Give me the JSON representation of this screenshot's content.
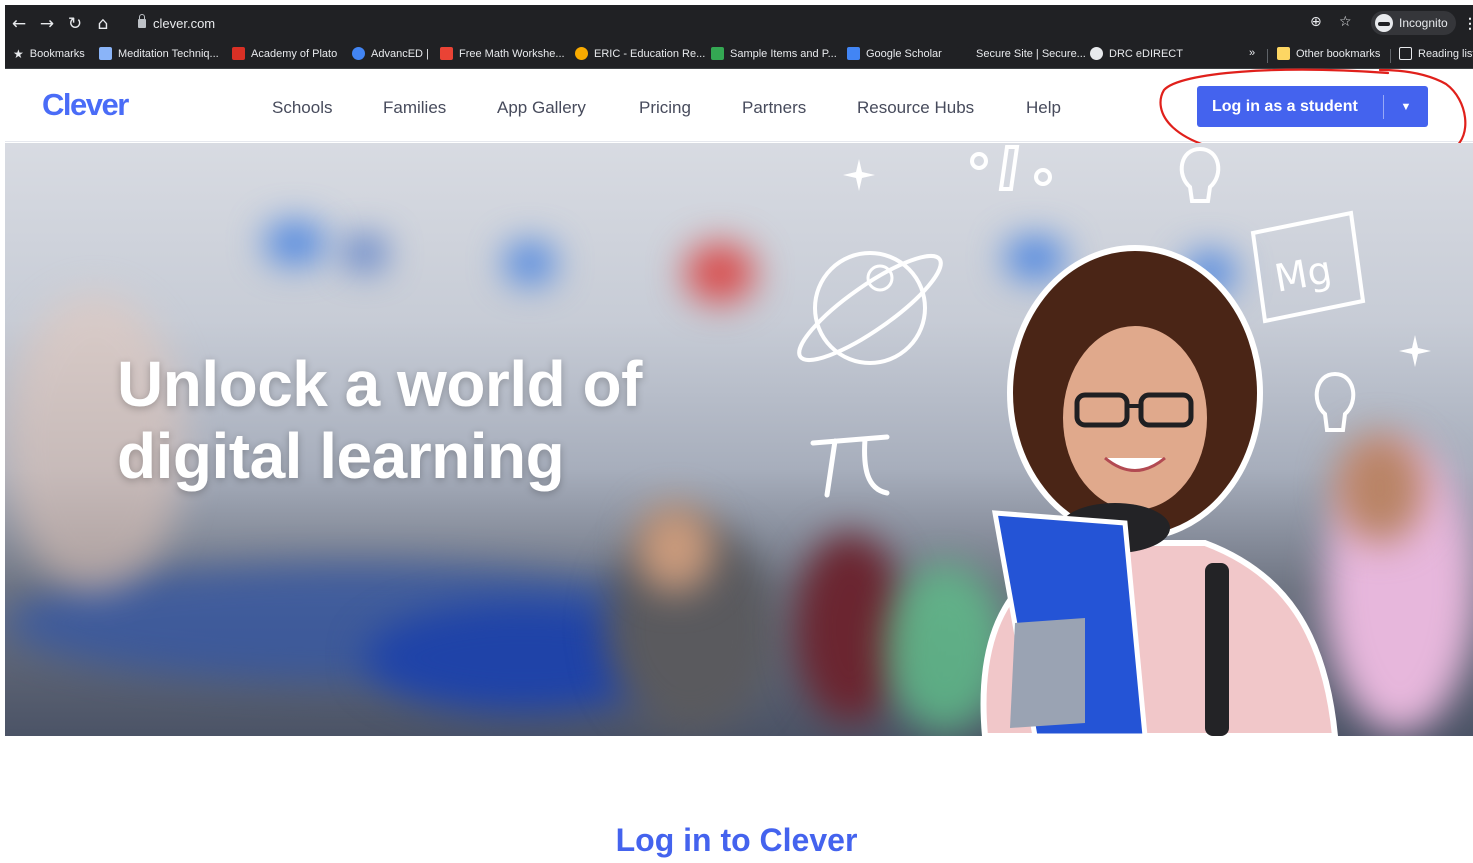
{
  "browser": {
    "url": "clever.com",
    "incognito_label": "Incognito",
    "bookmarks": [
      {
        "label": "Bookmarks",
        "color": "#e8eaed"
      },
      {
        "label": "Meditation Techniq...",
        "color": "#8ab4f8"
      },
      {
        "label": "Academy of Plato",
        "color": "#d93025"
      },
      {
        "label": "AdvancED |",
        "color": "#4285f4"
      },
      {
        "label": "Free Math Workshe...",
        "color": "#ea4335"
      },
      {
        "label": "ERIC - Education Re...",
        "color": "#f9ab00"
      },
      {
        "label": "Sample Items and P...",
        "color": "#34a853"
      },
      {
        "label": "Google Scholar",
        "color": "#4285f4"
      },
      {
        "label": "Secure Site | Secure...",
        "color": "#202124"
      },
      {
        "label": "DRC eDIRECT",
        "color": "#e8eaed"
      }
    ],
    "overflow_label": "»",
    "other_bookmarks": "Other bookmarks",
    "reading_list": "Reading list"
  },
  "header": {
    "logo": "Clever",
    "nav": [
      "Schools",
      "Families",
      "App Gallery",
      "Pricing",
      "Partners",
      "Resource Hubs",
      "Help"
    ],
    "login_button": "Log in as a student",
    "accent_color": "#4463ee"
  },
  "hero": {
    "title_line1": "Unlock a world of",
    "title_line2": "digital learning",
    "doodle_text": "Mg"
  },
  "main": {
    "login_heading": "Log in to Clever"
  }
}
